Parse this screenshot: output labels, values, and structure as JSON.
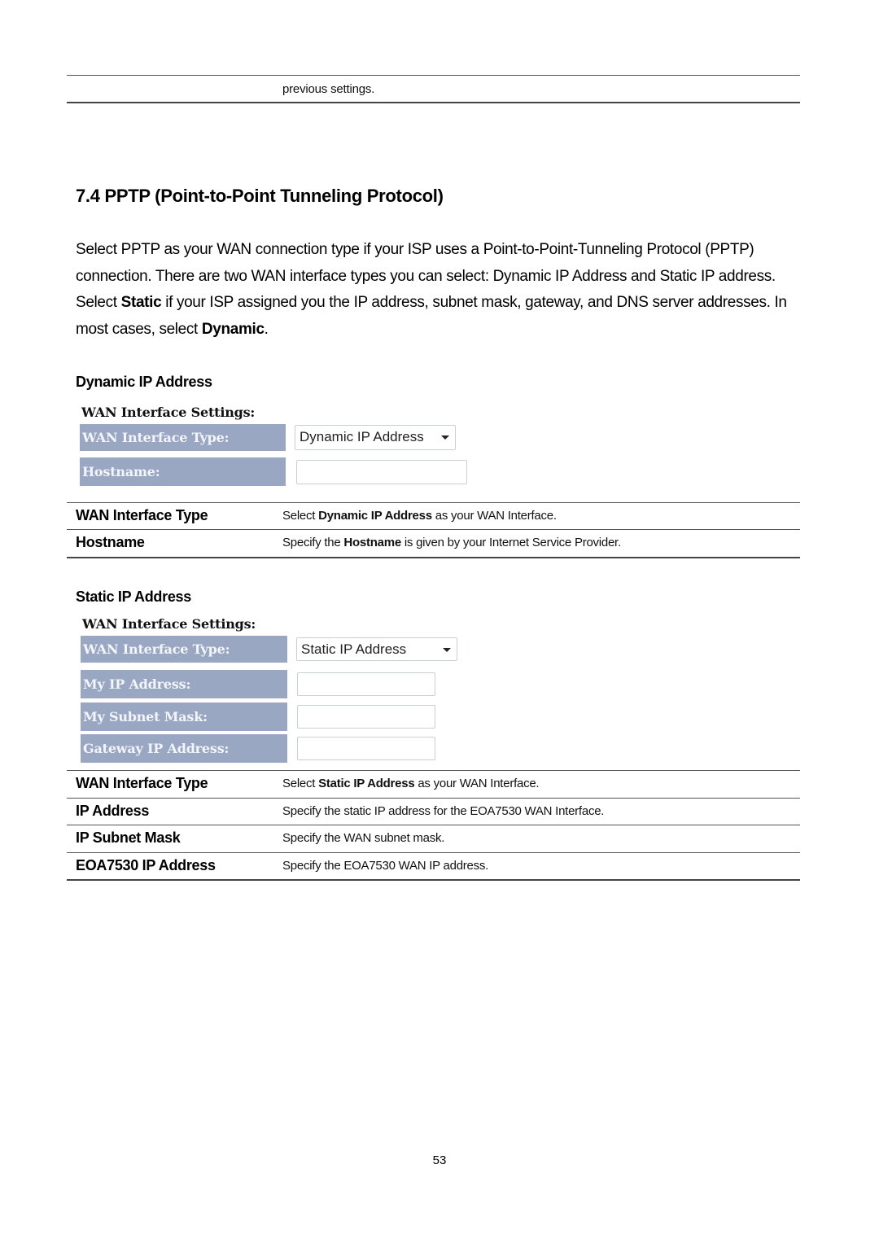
{
  "top_table": {
    "continued_text": "previous settings."
  },
  "section": {
    "title": "7.4 PPTP (Point-to-Point Tunneling Protocol)",
    "intro": {
      "part1": "Select PPTP as your WAN connection type if your ISP uses a Point-to-Point-Tunneling Protocol (PPTP) connection. There are two WAN interface types you can select: Dynamic IP Address and Static IP address. Select ",
      "bold1": "Static",
      "part2": " if your ISP assigned you the IP address, subnet mask, gateway, and DNS server addresses. In most cases, select ",
      "bold2": "Dynamic",
      "part3": "."
    }
  },
  "dynamic": {
    "heading": "Dynamic IP Address",
    "form": {
      "title": "WAN Interface Settings:",
      "rows": [
        {
          "label": "WAN Interface Type:",
          "type": "select",
          "value": "Dynamic IP Address"
        },
        {
          "label": "Hostname:",
          "type": "input",
          "value": ""
        }
      ]
    },
    "table": [
      {
        "term": "WAN Interface Type",
        "pre": "Select ",
        "bold": "Dynamic IP Address",
        "post": " as your WAN Interface."
      },
      {
        "term": "Hostname",
        "pre": "Specify the ",
        "bold": "Hostname",
        "post": " is given by your Internet Service Provider."
      }
    ]
  },
  "static": {
    "heading": "Static IP Address",
    "form": {
      "title": "WAN Interface Settings:",
      "rows": [
        {
          "label": "WAN Interface Type:",
          "type": "select",
          "value": "Static IP Address"
        },
        {
          "label": "My IP Address:",
          "type": "input",
          "value": ""
        },
        {
          "label": "My Subnet Mask:",
          "type": "input",
          "value": ""
        },
        {
          "label": "Gateway IP Address:",
          "type": "input",
          "value": ""
        }
      ]
    },
    "table": [
      {
        "term": "WAN Interface Type",
        "pre": "Select ",
        "bold": "Static IP Address",
        "post": " as your WAN Interface."
      },
      {
        "term": "IP Address",
        "pre": "Specify the static IP address for the EOA7530 WAN Interface.",
        "bold": "",
        "post": ""
      },
      {
        "term": "IP Subnet Mask",
        "pre": "Specify the WAN subnet mask.",
        "bold": "",
        "post": ""
      },
      {
        "term": "EOA7530 IP Address",
        "pre": "Specify the EOA7530 WAN IP address.",
        "bold": "",
        "post": ""
      }
    ]
  },
  "footer": {
    "page_number": "53"
  }
}
